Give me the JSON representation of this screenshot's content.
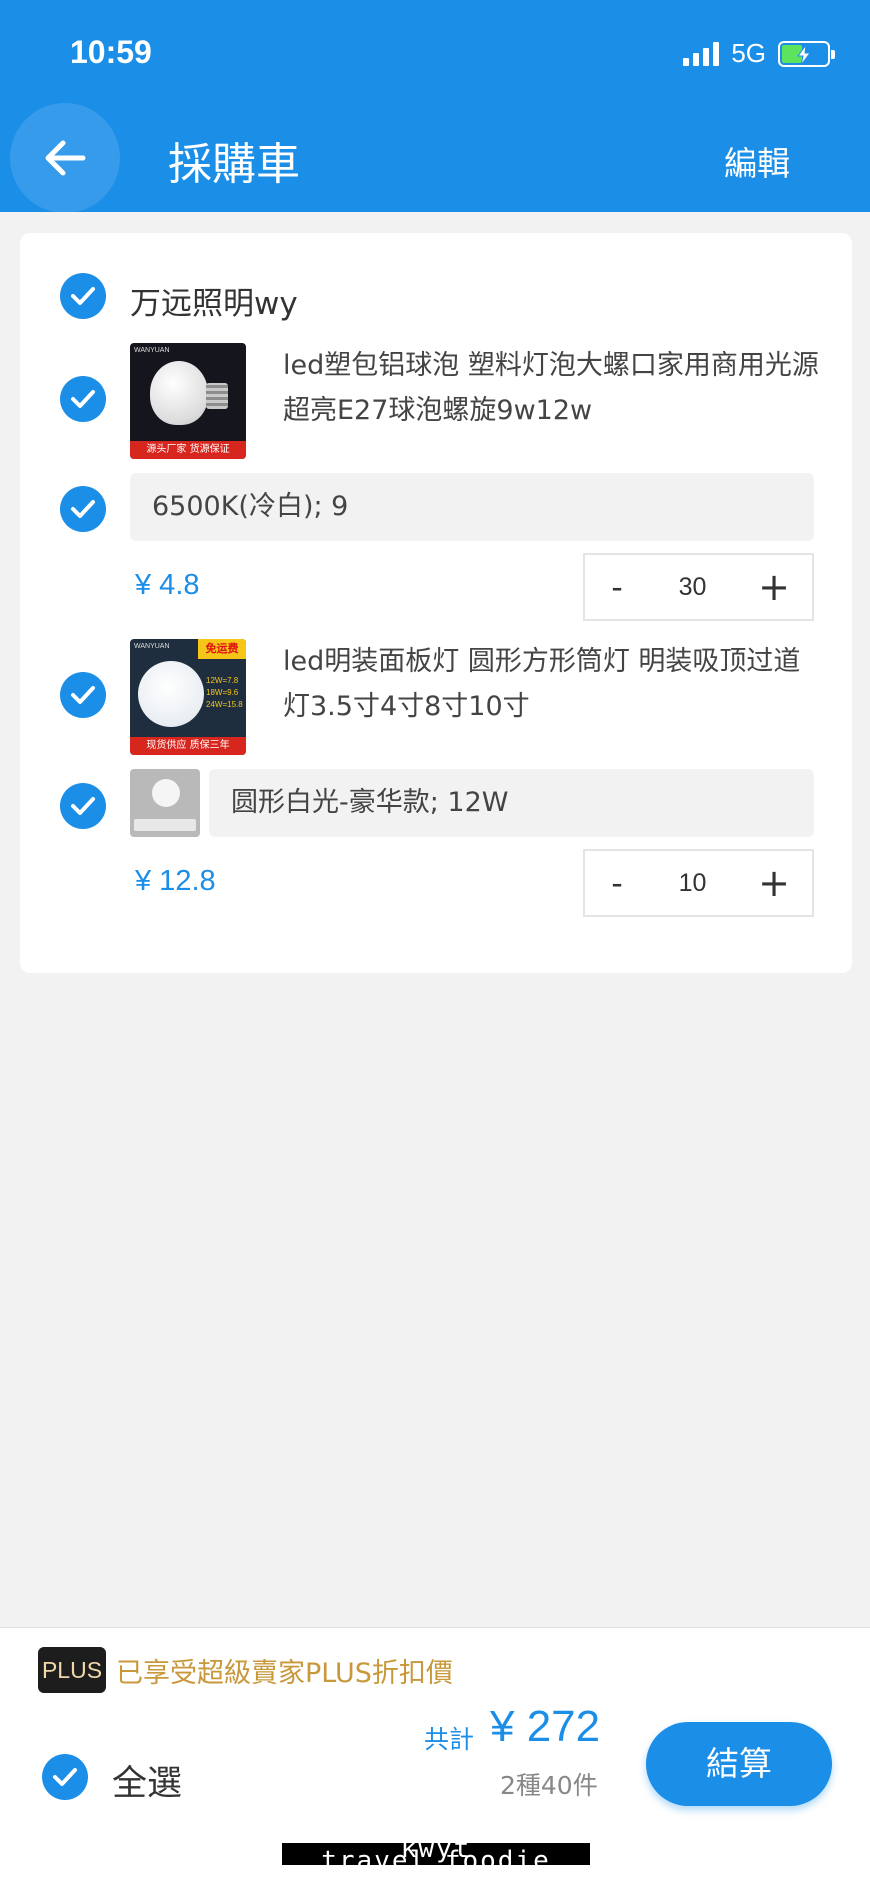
{
  "status_bar": {
    "time": "10:59",
    "network": "5G"
  },
  "header": {
    "title": "採購車",
    "edit_label": "編輯"
  },
  "shop": {
    "name": "万远照明wy"
  },
  "products": [
    {
      "title": "led塑包铝球泡 塑料灯泡大螺口家用商用光源超亮E27球泡螺旋9w12w",
      "thumb_brand": "WANYUAN",
      "thumb_ribbon": "源头厂家 货源保证",
      "variant": "6500K(冷白); 9",
      "price": "¥ 4.8",
      "quantity": "30"
    },
    {
      "title": "led明装面板灯 圆形方形筒灯 明装吸顶过道灯3.5寸4寸8寸10寸",
      "thumb_brand": "WANYUAN",
      "thumb_promo": "免运费",
      "thumb_specs": [
        "12W=7.8",
        "18W=9.6",
        "24W=15.8"
      ],
      "thumb_ribbon": "现货供应 质保三年",
      "variant": "圆形白光-豪华款; 12W",
      "price": "¥ 12.8",
      "quantity": "10"
    }
  ],
  "stepper": {
    "minus": "-",
    "plus": "+"
  },
  "footer": {
    "plus_badge": "PLUS",
    "plus_text": "已享受超級賣家PLUS折扣價",
    "select_all": "全選",
    "total_label": "共計",
    "total_amount": "¥ 272",
    "total_count": "2種40件",
    "checkout": "結算"
  },
  "watermark": "kwyt travel.foodie",
  "colors": {
    "accent": "#1b8ee8",
    "plus_gold": "#c8983a"
  }
}
